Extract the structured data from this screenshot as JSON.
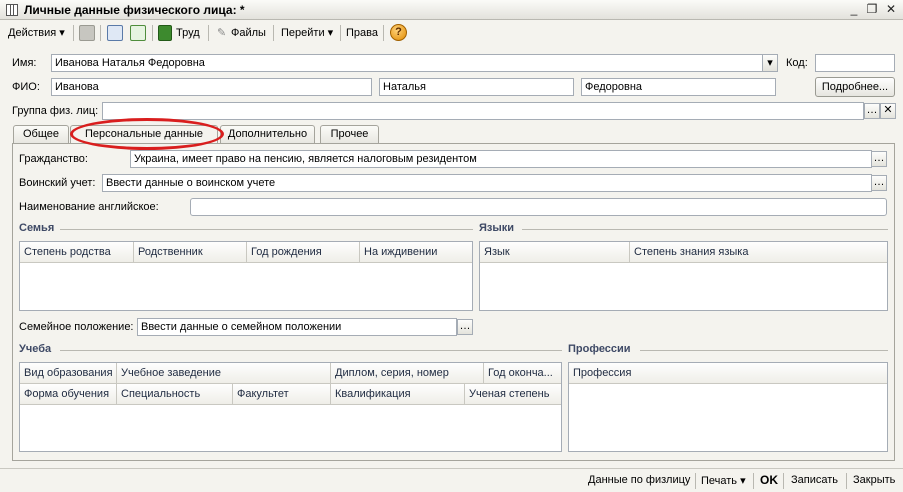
{
  "window": {
    "title": "Личные данные физического лица: *",
    "minimize": "_",
    "restore": "❐",
    "close": "✕"
  },
  "toolbar": {
    "actions": "Действия ▾",
    "labor": "Труд",
    "files": "Файлы",
    "goto": "Перейти ▾",
    "rights": "Права",
    "help": "?"
  },
  "header": {
    "name_label": "Имя:",
    "name_value": "Иванова Наталья Федоровна",
    "code_label": "Код:",
    "code_value": "",
    "fio_label": "ФИО:",
    "last_name": "Иванова",
    "first_name": "Наталья",
    "patronymic": "Федоровна",
    "more_button": "Подробнее...",
    "group_label": "Группа физ. лиц:",
    "group_value": ""
  },
  "tabs": [
    "Общее",
    "Персональные данные",
    "Дополнительно",
    "Прочее"
  ],
  "personal": {
    "citizenship_label": "Гражданство:",
    "citizenship_value": "Украина, имеет право на пенсию, является налоговым резидентом",
    "military_label": "Воинский учет:",
    "military_value": "Ввести данные о воинском учете",
    "english_name_label": "Наименование английское:",
    "english_name_value": "",
    "family_title": "Семья",
    "family_columns": [
      "Степень родства",
      "Родственник",
      "Год рождения",
      "На иждивении"
    ],
    "languages_title": "Языки",
    "languages_columns": [
      "Язык",
      "Степень знания языка"
    ],
    "marital_label": "Семейное положение:",
    "marital_value": "Ввести данные о семейном положении",
    "education_title": "Учеба",
    "education_columns_row1": [
      "Вид образования",
      "Учебное заведение",
      "Диплом, серия, номер",
      "Год оконча..."
    ],
    "education_columns_row2": [
      "Форма обучения",
      "Специальность",
      "Факультет",
      "Квалификация",
      "Ученая степень"
    ],
    "professions_title": "Профессии",
    "professions_columns": [
      "Профессия"
    ]
  },
  "statusbar": {
    "individual_data": "Данные по физлицу",
    "print": "Печать ▾",
    "ok": "OK",
    "save": "Записать",
    "close": "Закрыть"
  },
  "colors": {
    "highlight_ring": "#d91e1e",
    "section_title": "#3f4a66"
  }
}
